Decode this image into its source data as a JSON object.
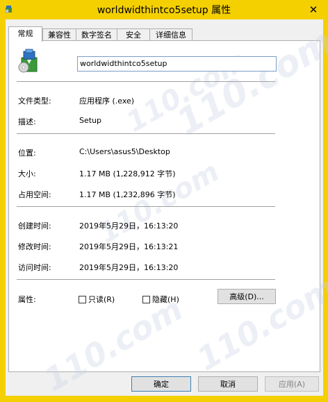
{
  "window": {
    "title": "worldwidthintco5setup 属性",
    "close_glyph": "✕"
  },
  "tabs": [
    {
      "label": "常规",
      "active": true
    },
    {
      "label": "兼容性",
      "active": false
    },
    {
      "label": "数字签名",
      "active": false
    },
    {
      "label": "安全",
      "active": false
    },
    {
      "label": "详细信息",
      "active": false
    }
  ],
  "general": {
    "file_name": "worldwidthintco5setup",
    "file_type_label": "文件类型:",
    "file_type_value": "应用程序 (.exe)",
    "description_label": "描述:",
    "description_value": "Setup",
    "location_label": "位置:",
    "location_value": "C:\\Users\\asus5\\Desktop",
    "size_label": "大小:",
    "size_value": "1.17 MB (1,228,912 字节)",
    "size_on_disk_label": "占用空间:",
    "size_on_disk_value": "1.17 MB (1,232,896 字节)",
    "created_label": "创建时间:",
    "created_value": "2019年5月29日，16:13:20",
    "modified_label": "修改时间:",
    "modified_value": "2019年5月29日，16:13:21",
    "accessed_label": "访问时间:",
    "accessed_value": "2019年5月29日，16:13:20",
    "attributes_label": "属性:",
    "readonly_label": "只读(R)",
    "hidden_label": "隐藏(H)",
    "advanced_button": "高级(D)..."
  },
  "footer": {
    "ok_label": "确定",
    "cancel_label": "取消",
    "apply_label": "应用(A)"
  },
  "watermark": {
    "text": "110.com"
  },
  "icons": {
    "app": "installer-package-icon",
    "file": "installer-package-icon"
  },
  "colors": {
    "titlebar": "#f4d000",
    "panel": "#ffffff",
    "dialog": "#f0f0f0",
    "input_border": "#7a9cc6"
  }
}
